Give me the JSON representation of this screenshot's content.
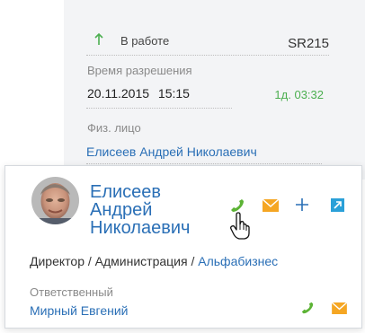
{
  "case_card": {
    "status": "В работе",
    "number": "SR215",
    "resolution_label": "Время разрешения",
    "resolution_date": "20.11.2015 15:15",
    "elapsed": "1д. 03:32",
    "contact_label": "Физ. лицо",
    "contact_name": "Елисеев Андрей Николаевич"
  },
  "popup": {
    "name_lines": [
      "Елисеев",
      "Андрей",
      "Николаевич"
    ],
    "job_title": "Директор",
    "department": "Администрация",
    "account": "Альфабизнес",
    "separator": " / ",
    "owner_label": "Ответственный",
    "owner_name": "Мирный Евгений"
  },
  "icons": {
    "status": "arrow-up-icon",
    "call": "phone-icon",
    "email": "envelope-icon",
    "add": "plus-icon",
    "open": "open-external-icon",
    "cursor": "hand-pointer-icon"
  },
  "colors": {
    "link": "#2a6fb6",
    "phone": "#5cb335",
    "email": "#f5a623",
    "open": "#2aa0d8",
    "plus": "#2a6fb6",
    "elapsed": "#4caf50"
  }
}
